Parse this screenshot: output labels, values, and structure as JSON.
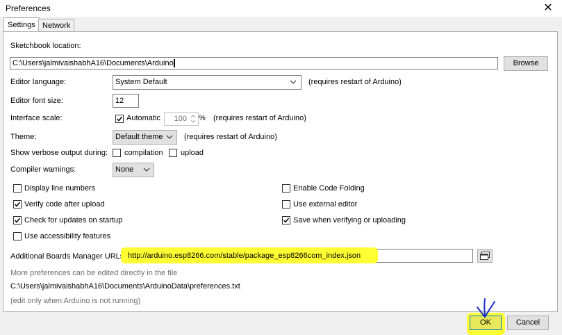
{
  "window": {
    "title": "Preferences",
    "close": "✕"
  },
  "tabs": [
    {
      "label": "Settings"
    },
    {
      "label": "Network"
    }
  ],
  "settings": {
    "sketchbook_label": "Sketchbook location:",
    "sketchbook_path": "C:\\Users\\jalmivaishabhA16\\Documents\\Arduino",
    "browse_label": "Browse",
    "editor_language_label": "Editor language:",
    "editor_language_value": "System Default",
    "restart_note": "(requires restart of Arduino)",
    "font_size_label": "Editor font size:",
    "font_size_value": "12",
    "interface_scale_label": "Interface scale:",
    "automatic_label": "Automatic",
    "scale_value": "100",
    "percent": "%",
    "theme_label": "Theme:",
    "theme_value": "Default theme",
    "verbose_label": "Show verbose output during:",
    "compilation_label": "compilation",
    "upload_label": "upload",
    "warnings_label": "Compiler warnings:",
    "warnings_value": "None",
    "options_left": [
      {
        "label": "Display line numbers",
        "checked": false
      },
      {
        "label": "Verify code after upload",
        "checked": true
      },
      {
        "label": "Check for updates on startup",
        "checked": true
      },
      {
        "label": "Use accessibility features",
        "checked": false
      }
    ],
    "options_right": [
      {
        "label": "Enable Code Folding",
        "checked": false
      },
      {
        "label": "Use external editor",
        "checked": false
      },
      {
        "label": "Save when verifying or uploading",
        "checked": true
      }
    ],
    "boards_label": "Additional Boards Manager URLs:",
    "boards_url": "http://arduino.esp8266.com/stable/package_esp8266com_index.json",
    "more_prefs": "More preferences can be edited directly in the file",
    "prefs_path": "C:\\Users\\jalmivaishabhA16\\Documents\\ArduinoData\\preferences.txt",
    "edit_note": "(edit only when Arduino is not running)"
  },
  "footer": {
    "ok_label": "OK",
    "cancel_label": "Cancel"
  },
  "colors": {
    "highlight": "#ffff33",
    "annotation_arrow": "#1a2cc8"
  }
}
